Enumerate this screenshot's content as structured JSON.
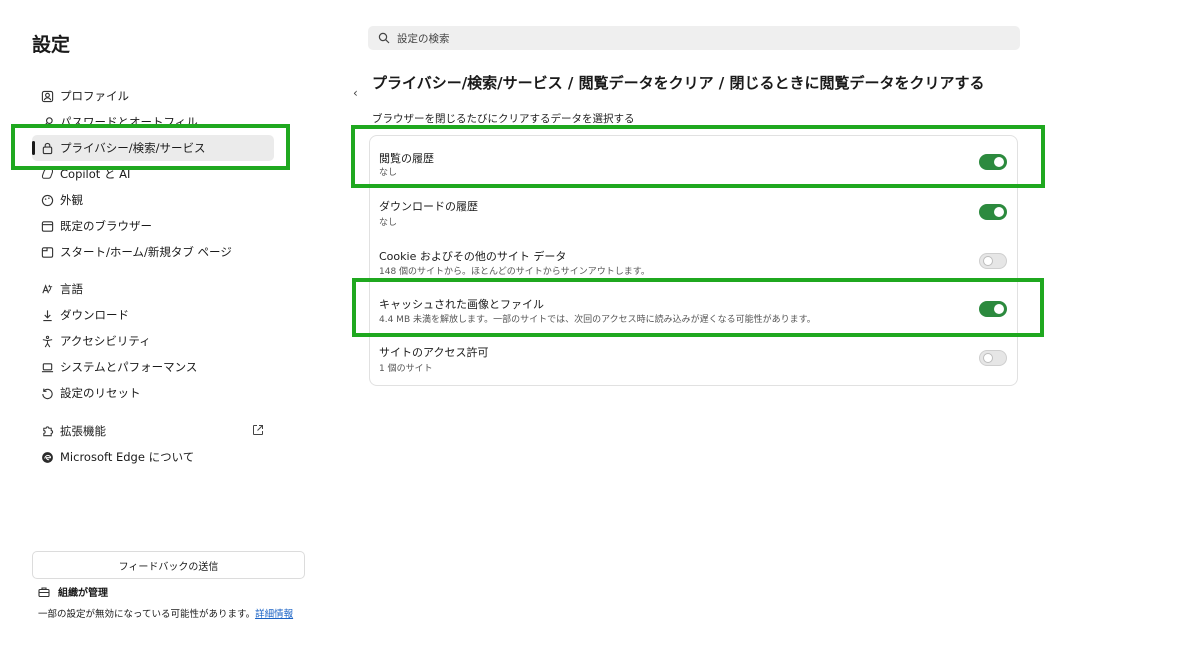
{
  "app": {
    "title": "設定"
  },
  "search": {
    "placeholder": "設定の検索"
  },
  "sidebar": {
    "items": [
      {
        "label": "プロファイル",
        "icon": "profile-icon"
      },
      {
        "label": "パスワードとオートフィル",
        "icon": "key-icon"
      },
      {
        "label": "プライバシー/検索/サービス",
        "icon": "lock-icon",
        "active": true
      },
      {
        "label": "Copilot と AI",
        "icon": "copilot-icon"
      },
      {
        "label": "外観",
        "icon": "appearance-icon"
      },
      {
        "label": "既定のブラウザー",
        "icon": "browser-icon"
      },
      {
        "label": "スタート/ホーム/新規タブ ページ",
        "icon": "home-icon"
      },
      {
        "label": "言語",
        "icon": "language-icon"
      },
      {
        "label": "ダウンロード",
        "icon": "download-icon"
      },
      {
        "label": "アクセシビリティ",
        "icon": "accessibility-icon"
      },
      {
        "label": "システムとパフォーマンス",
        "icon": "laptop-icon"
      },
      {
        "label": "設定のリセット",
        "icon": "reset-icon"
      },
      {
        "label": "拡張機能",
        "icon": "extensions-icon"
      },
      {
        "label": "Microsoft Edge について",
        "icon": "edge-icon"
      }
    ],
    "feedback_label": "フィードバックの送信",
    "managed_label": "組織が管理",
    "managed_note": "一部の設定が無効になっている可能性があります。",
    "managed_link": "詳細情報"
  },
  "main": {
    "heading": "プライバシー/検索/サービス / 閲覧データをクリア / 閉じるときに閲覧データをクリアする",
    "subheading": "ブラウザーを閉じるたびにクリアするデータを選択する",
    "rows": [
      {
        "title": "閲覧の履歴",
        "desc": "なし",
        "enabled": true
      },
      {
        "title": "ダウンロードの履歴",
        "desc": "なし",
        "enabled": true
      },
      {
        "title": "Cookie およびその他のサイト データ",
        "desc": "148 個のサイトから。ほとんどのサイトからサインアウトします。",
        "enabled": false
      },
      {
        "title": "キャッシュされた画像とファイル",
        "desc": "4.4 MB 未満を解放します。一部のサイトでは、次回のアクセス時に読み込みが遅くなる可能性があります。",
        "enabled": true
      },
      {
        "title": "サイトのアクセス許可",
        "desc": "1 個のサイト",
        "enabled": false
      }
    ]
  },
  "colors": {
    "accent": "#2c8a3e",
    "highlight": "#1fa81f",
    "link": "#1a62c5"
  }
}
